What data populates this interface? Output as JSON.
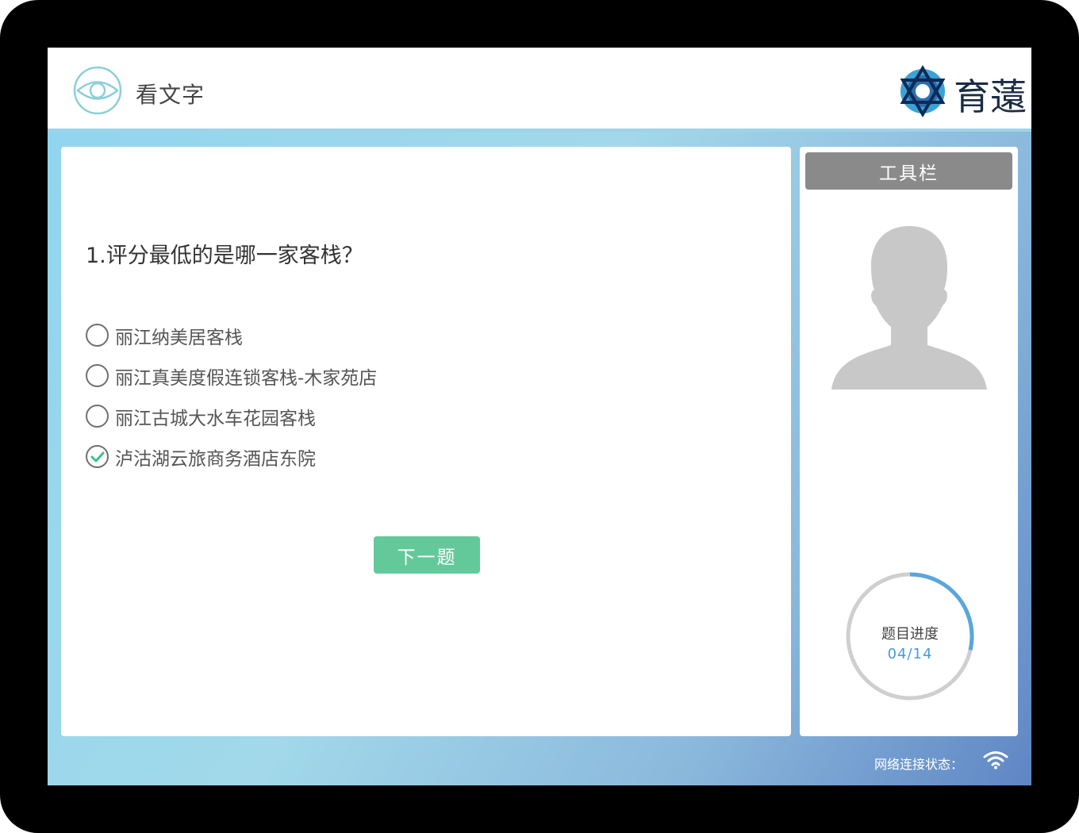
{
  "header": {
    "title": "看文字",
    "logo_text": "育薳"
  },
  "question": {
    "text": "1.评分最低的是哪一家客栈？",
    "options": [
      {
        "label": "丽江纳美居客栈",
        "selected": false
      },
      {
        "label": "丽江真美度假连锁客栈-木家苑店",
        "selected": false
      },
      {
        "label": "丽江古城大水车花园客栈",
        "selected": false
      },
      {
        "label": "泸沽湖云旅商务酒店东院",
        "selected": true
      }
    ],
    "next_label": "下一题"
  },
  "sidebar": {
    "toolbar_label": "工具栏",
    "progress_label": "题目进度",
    "progress_value": "04/14",
    "progress_fraction": 0.2857
  },
  "footer": {
    "network_label": "网络连接状态："
  },
  "colors": {
    "accent_green": "#63c99a",
    "progress_blue": "#5aa6dc",
    "eye_teal": "#8ccfd9"
  },
  "icons": {
    "header_left": "eye-icon",
    "header_right": "logo-icon",
    "selected_option": "check-icon",
    "avatar": "user-silhouette-icon",
    "network": "wifi-icon"
  }
}
